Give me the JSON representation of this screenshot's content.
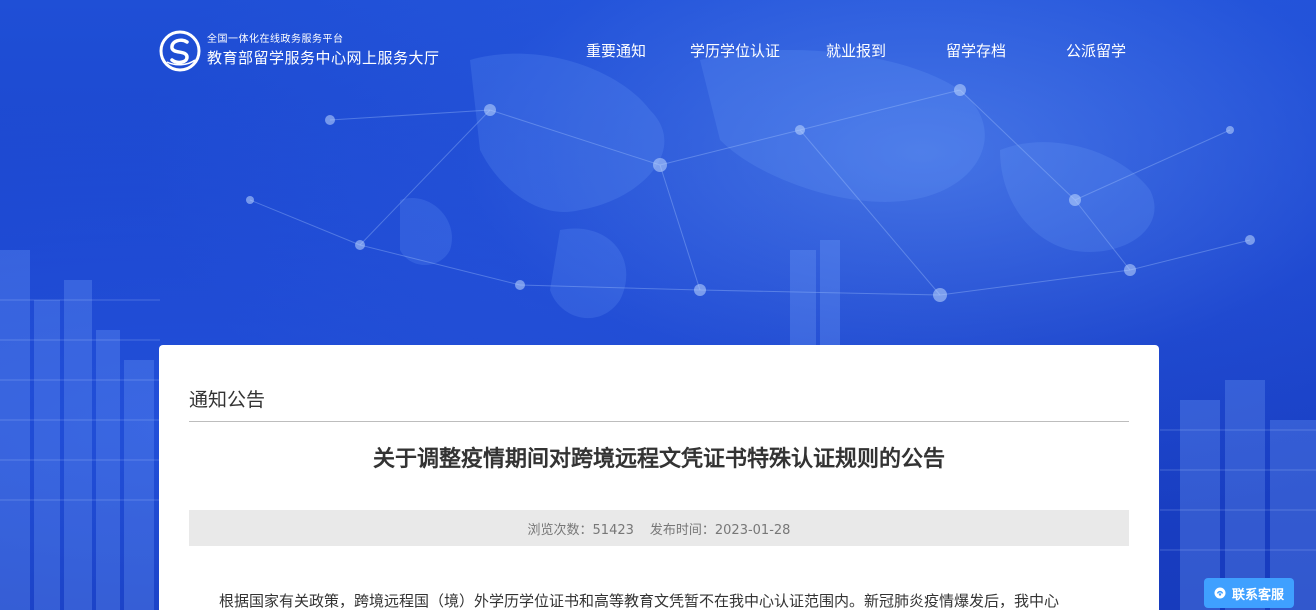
{
  "header": {
    "logo_subtitle": "全国一体化在线政务服务平台",
    "logo_title": "教育部留学服务中心网上服务大厅"
  },
  "nav": {
    "items": [
      {
        "label": "重要通知"
      },
      {
        "label": "学历学位认证"
      },
      {
        "label": "就业报到"
      },
      {
        "label": "留学存档"
      },
      {
        "label": "公派留学"
      }
    ]
  },
  "notice": {
    "section_title": "通知公告",
    "article_title": "关于调整疫情期间对跨境远程文凭证书特殊认证规则的公告",
    "views": "浏览次数：51423",
    "publish_time": "发布时间：2023-01-28",
    "body_first_line": "根据国家有关政策，跨境远程国（境）外学历学位证书和高等教育文凭暂不在我中心认证范围内。新冠肺炎疫情爆发后，我中心"
  },
  "service": {
    "label": "联系客服"
  },
  "colors": {
    "hero_blue": "#1a3fc4",
    "service_button": "#3fa0ff"
  }
}
